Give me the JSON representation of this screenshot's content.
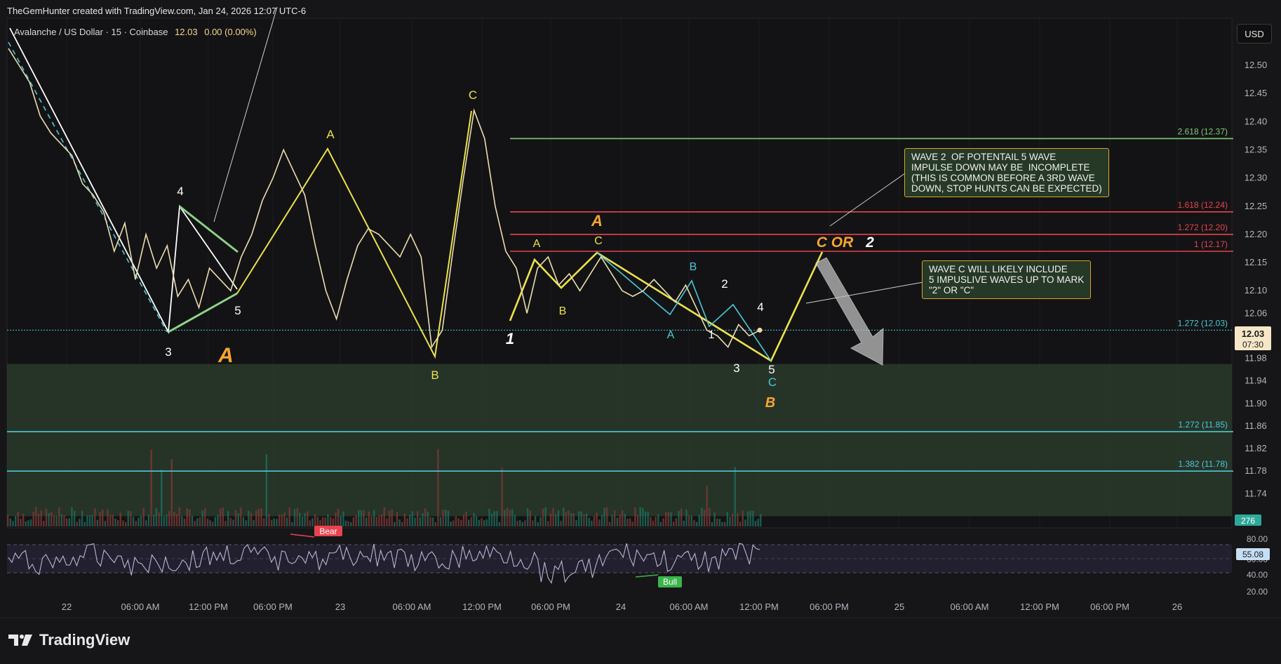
{
  "header": {
    "text": "TheGemHunter created with TradingView.com, Jan 24, 2026 12:07 UTC-6"
  },
  "symbol_bar": {
    "name": "Avalanche / US Dollar · 15 · Coinbase",
    "price": "12.03",
    "change": "0.00 (0.00%)"
  },
  "currency_button": "USD",
  "brand": "TradingView",
  "colors": {
    "bg": "#161618",
    "grid": "#1e1e21",
    "price_line": "#ecdcaf",
    "yellow": "#ebe24b",
    "orange": "#f7a531",
    "red_fib": "#e8434f",
    "green_fib": "#7ecb7a",
    "teal": "#4cc8d8",
    "zone": "#2a3b2b"
  },
  "notes": [
    {
      "id": "note1",
      "text": "WAVE 2  OF POTENTAIL 5 WAVE\nIMPULSE DOWN MAY BE  INCOMPLETE\n(THIS IS COMMON BEFORE A 3RD WAVE\nDOWN, STOP HUNTS CAN BE EXPECTED)"
    },
    {
      "id": "note2",
      "text": "WAVE C WILL LIKELY INCLUDE\n5 IMPUSLIVE WAVES UP TO MARK\n\"2\" OR \"C\""
    }
  ],
  "chart_data": {
    "type": "line",
    "main": {
      "ylim": [
        11.7,
        12.55
      ],
      "y_ticks": [
        "12.50",
        "12.45",
        "12.40",
        "12.35",
        "12.30",
        "12.25",
        "12.20",
        "12.15",
        "12.10",
        "12.06",
        "12.02",
        "11.98",
        "11.94",
        "11.90",
        "11.86",
        "11.82",
        "11.78",
        "11.74"
      ],
      "x_ticks": [
        "22",
        "06:00 AM",
        "12:00 PM",
        "06:00 PM",
        "23",
        "06:00 AM",
        "12:00 PM",
        "06:00 PM",
        "24",
        "06:00 AM",
        "12:00 PM",
        "06:00 PM",
        "25",
        "06:00 AM",
        "12:00 PM",
        "06:00 PM",
        "26"
      ],
      "price_series": [
        [
          -2,
          12.53
        ],
        [
          -1,
          12.5
        ],
        [
          0,
          12.47
        ],
        [
          1,
          12.41
        ],
        [
          2,
          12.38
        ],
        [
          3,
          12.36
        ],
        [
          4,
          12.34
        ],
        [
          5,
          12.29
        ],
        [
          6,
          12.27
        ],
        [
          7,
          12.24
        ],
        [
          8,
          12.17
        ],
        [
          9,
          12.22
        ],
        [
          10,
          12.12
        ],
        [
          11,
          12.2
        ],
        [
          12,
          12.14
        ],
        [
          13,
          12.18
        ],
        [
          14,
          12.09
        ],
        [
          15,
          12.12
        ],
        [
          16,
          12.07
        ],
        [
          17,
          12.14
        ],
        [
          18,
          12.12
        ],
        [
          19,
          12.1
        ],
        [
          20,
          12.16
        ],
        [
          21,
          12.2
        ],
        [
          22,
          12.26
        ],
        [
          23,
          12.3
        ],
        [
          24,
          12.35
        ],
        [
          25,
          12.31
        ],
        [
          26,
          12.27
        ],
        [
          27,
          12.18
        ],
        [
          28,
          12.1
        ],
        [
          29,
          12.05
        ],
        [
          30,
          12.12
        ],
        [
          31,
          12.18
        ],
        [
          32,
          12.21
        ],
        [
          33,
          12.2
        ],
        [
          34,
          12.18
        ],
        [
          35,
          12.16
        ],
        [
          36,
          12.2
        ],
        [
          37,
          12.16
        ],
        [
          38,
          12.0
        ],
        [
          39,
          12.03
        ],
        [
          40,
          12.17
        ],
        [
          41,
          12.3
        ],
        [
          42,
          12.42
        ],
        [
          43,
          12.37
        ],
        [
          44,
          12.25
        ],
        [
          45,
          12.17
        ],
        [
          46,
          12.14
        ],
        [
          47,
          12.06
        ],
        [
          48,
          12.14
        ],
        [
          49,
          12.16
        ],
        [
          50,
          12.11
        ],
        [
          51,
          12.13
        ],
        [
          52,
          12.1
        ],
        [
          53,
          12.13
        ],
        [
          54,
          12.16
        ],
        [
          55,
          12.13
        ],
        [
          56,
          12.1
        ],
        [
          57,
          12.09
        ],
        [
          58,
          12.1
        ],
        [
          59,
          12.12
        ],
        [
          60,
          12.1
        ],
        [
          61,
          12.08
        ],
        [
          62,
          12.11
        ],
        [
          63,
          12.07
        ],
        [
          64,
          12.03
        ],
        [
          65,
          12.02
        ],
        [
          66,
          12.0
        ],
        [
          67,
          12.04
        ],
        [
          68,
          12.02
        ],
        [
          69,
          12.03
        ]
      ],
      "x_range_index": [
        0,
        100
      ],
      "fib_levels": [
        {
          "label": "2.618 (12.37)",
          "value": 12.37,
          "color": "green"
        },
        {
          "label": "1.618 (12.24)",
          "value": 12.24,
          "color": "red"
        },
        {
          "label": "1.272 (12.20)",
          "value": 12.2,
          "color": "red"
        },
        {
          "label": "1 (12.17)",
          "value": 12.17,
          "color": "red"
        },
        {
          "label": "1.272 (12.03)",
          "value": 12.03,
          "color": "teal"
        },
        {
          "label": "1.272 (11.85)",
          "value": 11.85,
          "color": "teal"
        },
        {
          "label": "1.382 (11.78)",
          "value": 11.78,
          "color": "teal"
        }
      ],
      "support_zone": [
        11.7,
        11.97
      ],
      "current_price": {
        "value": "12.03",
        "countdown": "07:30"
      },
      "volume_badge": "276",
      "wave_labels": [
        "4",
        "5",
        "3",
        "A",
        "A",
        "B",
        "C",
        "1",
        "A",
        "B",
        "A",
        "C",
        "B",
        "2",
        "4",
        "1",
        "3",
        "5",
        "A",
        "C",
        "B",
        "C OR",
        "2"
      ]
    },
    "rsi": {
      "ticks": [
        "80.00",
        "60.00",
        "40.00",
        "20.00"
      ],
      "current": "55.08",
      "signals": [
        "Bear",
        "Bull"
      ]
    }
  }
}
